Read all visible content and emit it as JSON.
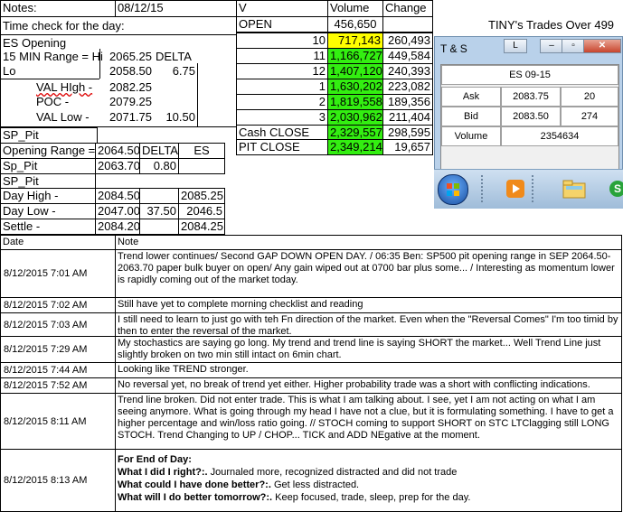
{
  "header": {
    "notes_label": "Notes:",
    "notes_date": "08/12/15",
    "time_check": "Time check for the day:",
    "tiny_title": "TINY's Trades Over 499"
  },
  "es": {
    "title": "ES Opening",
    "range_label": "15 MIN Range = Hi",
    "hi": "2065.25",
    "delta_label": "DELTA",
    "lo_label": "Lo",
    "lo": "2058.50",
    "delta": "6.75",
    "val_high_label": "VAL HIgh   -",
    "val_high": "2082.25",
    "poc_label": "POC    -",
    "poc": "2079.25",
    "val_low_label": "VAL Low   -",
    "val_low": "2071.75",
    "val_low_extra": "10.50"
  },
  "sp": {
    "title": "SP_Pit",
    "opening_range_label": "Opening Range =",
    "opening_range": "2064.50",
    "delta_label": "DELTA",
    "es_label": "ES",
    "sp_pit_label": "Sp_Pit",
    "sp_pit": "2063.70",
    "sp_pit_delta": "0.80",
    "sp_pit2_label": "SP_Pit",
    "day_high_label": "Day High -",
    "day_high": "2084.50",
    "day_high_es": "2085.25",
    "day_low_label": "Day Low -",
    "day_low": "2047.00",
    "day_low_delta": "37.50",
    "day_low_es": "2046.5",
    "settle_label": "Settle -",
    "settle": "2084.20",
    "settle_es": "2084.25"
  },
  "volume": {
    "col_v": "V",
    "col_volume": "Volume",
    "col_change": "Change",
    "rows": [
      {
        "label": "OPEN",
        "volume": "456,650",
        "change": ""
      },
      {
        "label": "10",
        "volume": "717,143",
        "change": "260,493"
      },
      {
        "label": "11",
        "volume": "1,166,727",
        "change": "449,584"
      },
      {
        "label": "12",
        "volume": "1,407,120",
        "change": "240,393"
      },
      {
        "label": "1",
        "volume": "1,630,202",
        "change": "223,082"
      },
      {
        "label": "2",
        "volume": "1,819,558",
        "change": "189,356"
      },
      {
        "label": "3",
        "volume": "2,030,962",
        "change": "211,404"
      },
      {
        "label": "Cash CLOSE",
        "volume": "2,329,557",
        "change": "298,595"
      },
      {
        "label": "PIT CLOSE",
        "volume": "2,349,214",
        "change": "19,657"
      }
    ]
  },
  "ts_window": {
    "title": "T & S",
    "btn_l": "L",
    "symbol": "ES 09-15",
    "ask_label": "Ask",
    "ask": "2083.75",
    "ask_size": "20",
    "bid_label": "Bid",
    "bid": "2083.50",
    "bid_size": "274",
    "volume_label": "Volume",
    "volume": "2354634"
  },
  "log": {
    "col_date": "Date",
    "col_note": "Note",
    "entries": [
      {
        "date": "8/12/2015 7:01 AM",
        "note": "Trend lower continues/ Second GAP DOWN OPEN DAY.  / 06:35 Ben: SP500 pit opening range in SEP 2064.50-2063.70 paper bulk buyer on open/ Any gain wiped out at 0700 bar plus some... /  Interesting as momentum lower is rapidly coming out of the market today."
      },
      {
        "date": "8/12/2015 7:02 AM",
        "note": "Still have yet to complete morning checklist and reading"
      },
      {
        "date": "8/12/2015 7:03 AM",
        "note": "I still need to learn to just go with teh Fn direction of the market.  Even when the \"Reversal Comes\" I'm too timid by then to enter the reversal of the market."
      },
      {
        "date": "8/12/2015 7:29 AM",
        "note": "My stochastics are saying go long.  My trend and trend line is saying SHORT the market... Well Trend Line just slightly broken on two min still intact on 6min chart."
      },
      {
        "date": "8/12/2015 7:44 AM",
        "note": "Looking like TREND stronger."
      },
      {
        "date": "8/12/2015 7:52 AM",
        "note": "No reversal yet, no break of trend yet either.  Higher probability trade was a short with conflicting indications."
      },
      {
        "date": "8/12/2015 8:11 AM",
        "note": "Trend line broken.  Did not enter trade.  This is what I am talking about.  I see, yet I am not acting on what I am seeing anymore.  What is going through my head I have not a clue, but it is formulating something.  I have to get a higher percentage and win/loss ratio going.  // STOCH coming to support SHORT on STC LTClagging still LONG STOCH.  Trend Changing to UP / CHOP... TICK and ADD NEgative at the moment."
      }
    ],
    "final_date": "8/12/2015 8:13 AM",
    "final": {
      "heading": "For End of Day:",
      "q1": "What I did I right?:.",
      "a1": " Journaled more, recognized distracted and did not trade",
      "q2": "What could I have done better?:.",
      "a2": " Get less distracted.",
      "q3": "What will I do better tomorrow?:.",
      "a3": " Keep focused, trade, sleep, prep for the day."
    }
  }
}
